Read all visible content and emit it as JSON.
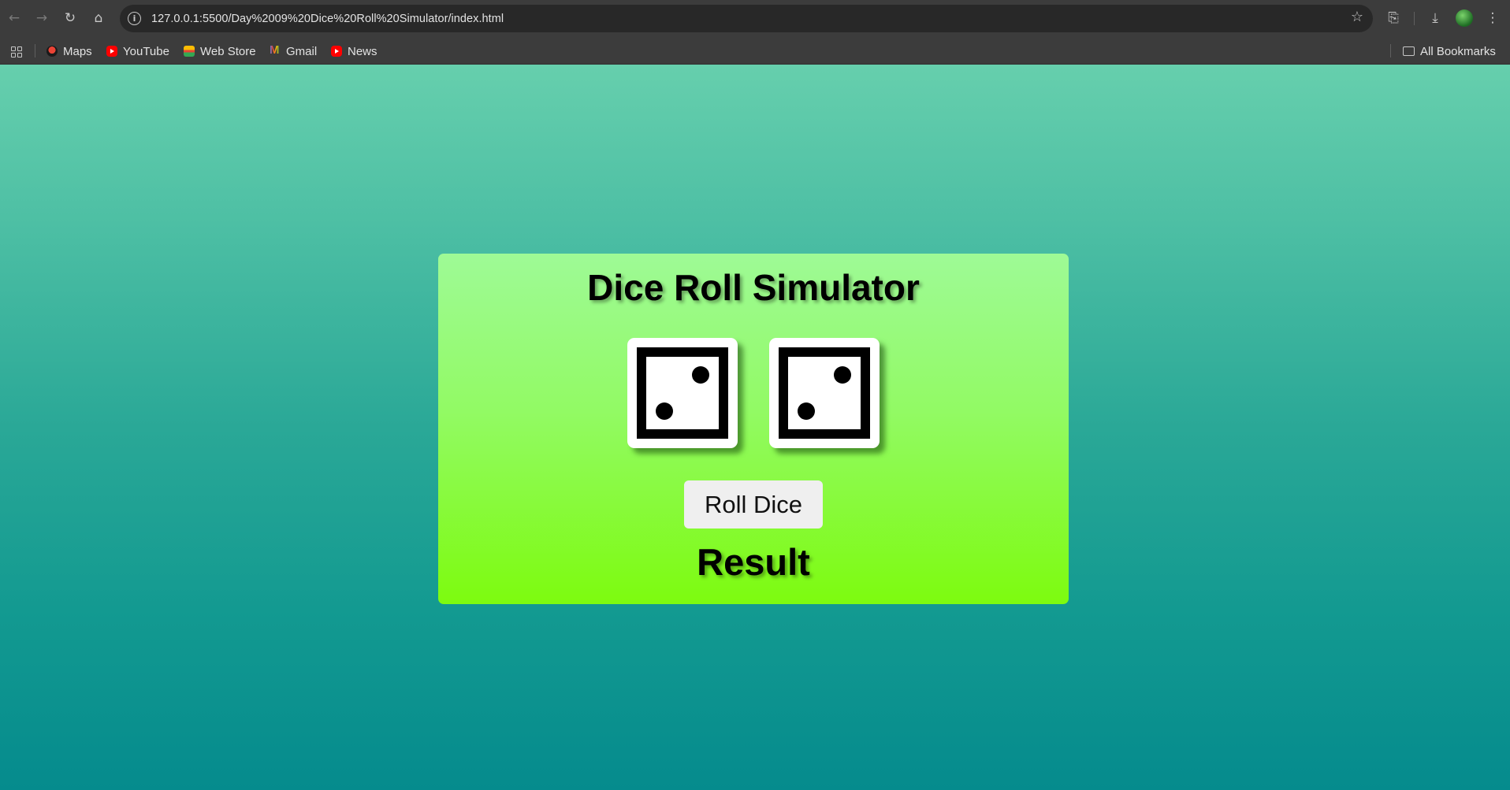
{
  "browser": {
    "url": "127.0.0.1:5500/Day%2009%20Dice%20Roll%20Simulator/index.html",
    "bookmarks": [
      {
        "label": "Maps",
        "icon": "maps-icon"
      },
      {
        "label": "YouTube",
        "icon": "youtube-icon"
      },
      {
        "label": "Web Store",
        "icon": "web-store-icon"
      },
      {
        "label": "Gmail",
        "icon": "gmail-icon"
      },
      {
        "label": "News",
        "icon": "youtube-icon"
      }
    ],
    "all_bookmarks_label": "All Bookmarks"
  },
  "app": {
    "title": "Dice Roll Simulator",
    "dice": [
      {
        "value": 2
      },
      {
        "value": 2
      }
    ],
    "roll_button_label": "Roll Dice",
    "result_text": "Result"
  },
  "colors": {
    "page_gradient_top": "#66cfad",
    "page_gradient_bottom": "#058b8d",
    "card_gradient_top": "#9efa96",
    "card_gradient_bottom": "#7dfb0f"
  }
}
